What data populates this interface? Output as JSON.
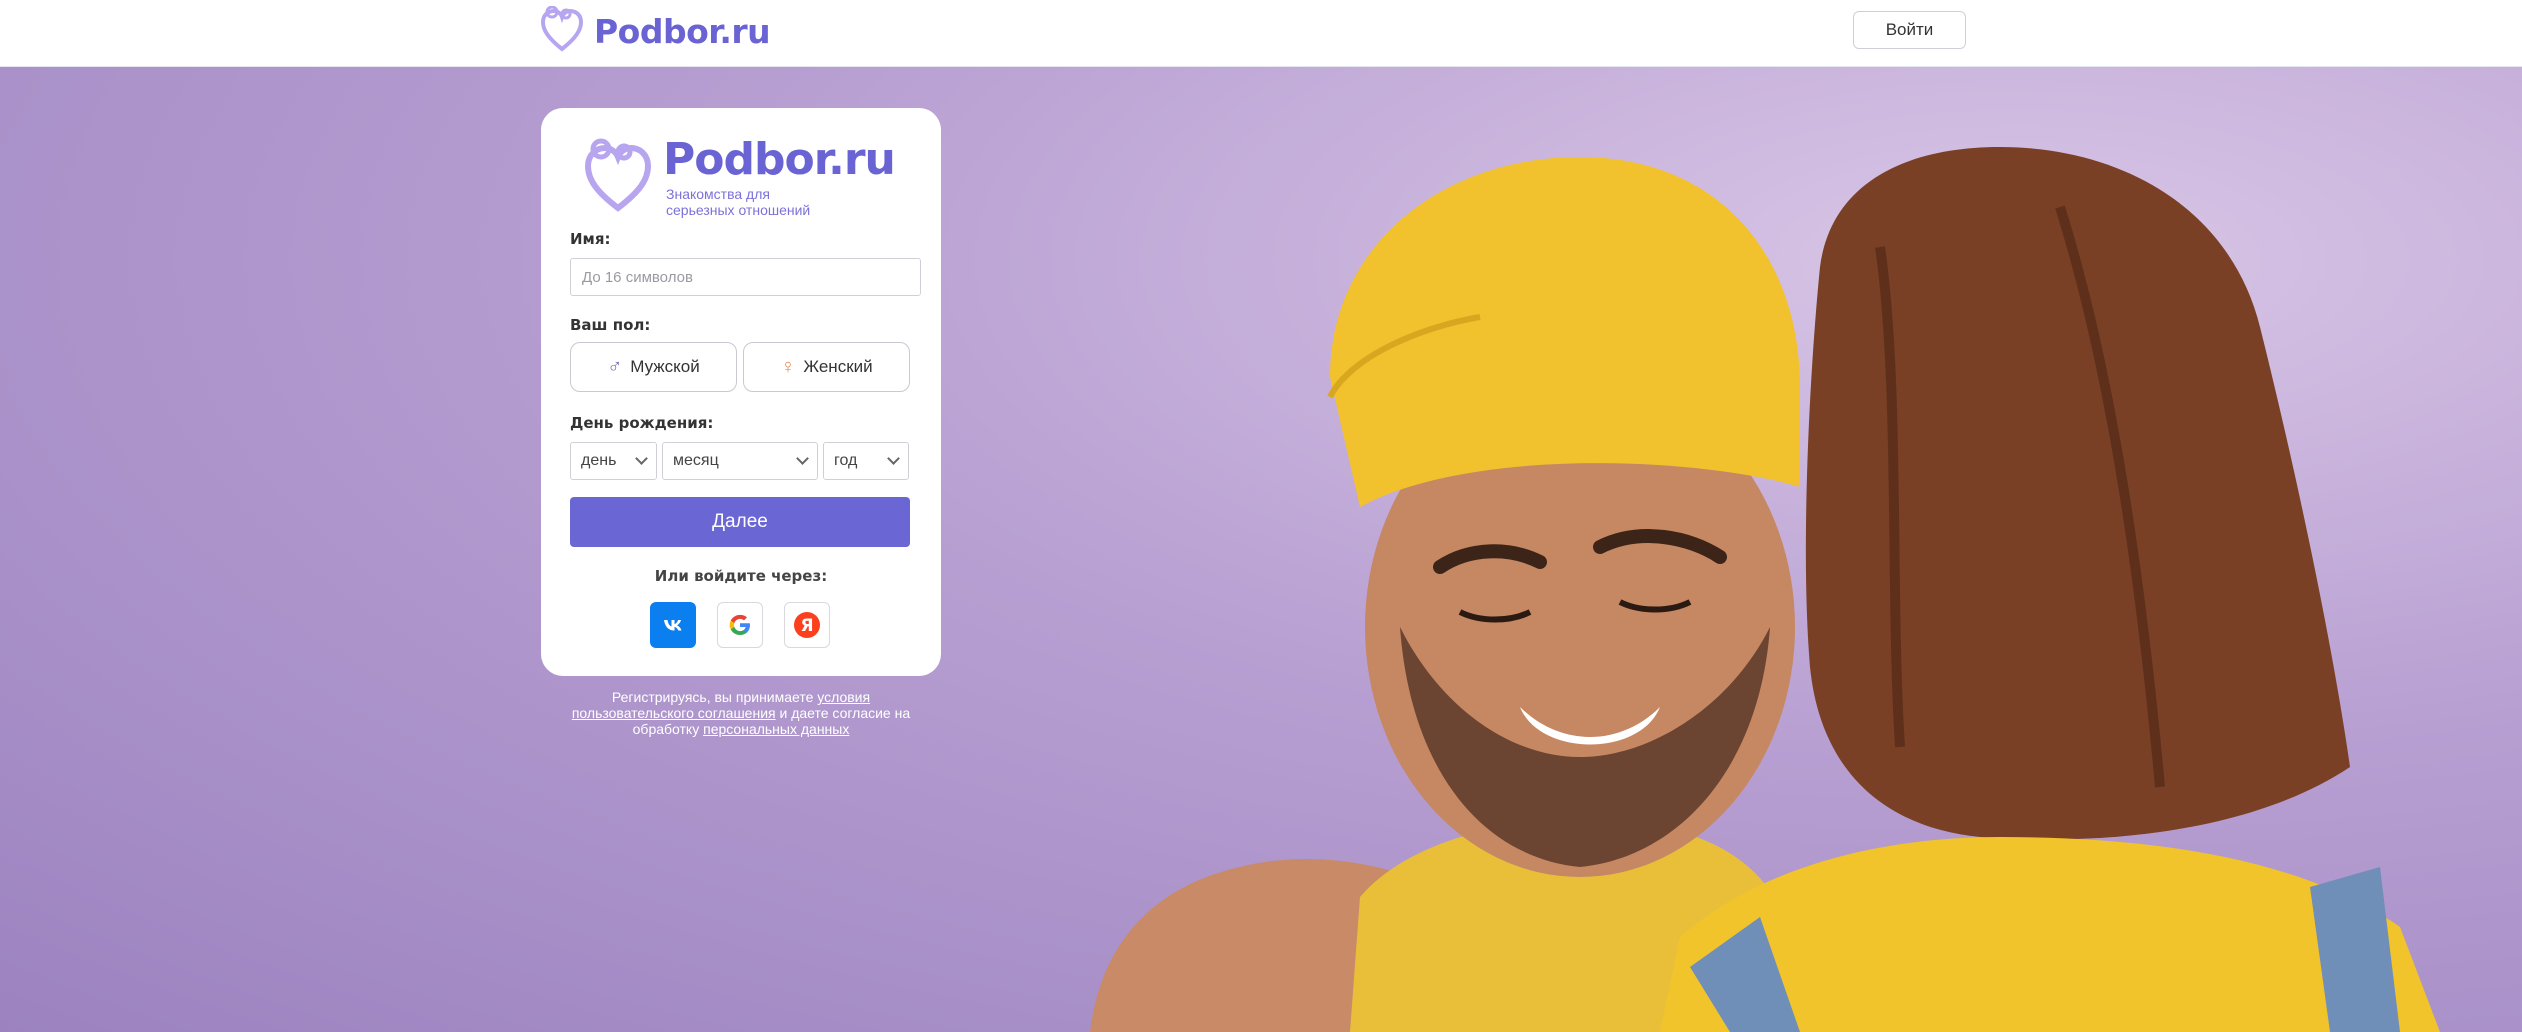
{
  "header": {
    "brand": "Podbor.ru",
    "login_label": "Войти"
  },
  "card": {
    "logo_title": "Podbor.ru",
    "logo_subtitle": "Знакомства для серьезных отношений",
    "name_label": "Имя:",
    "name_placeholder": "До 16 символов",
    "name_value": "",
    "gender_label": "Ваш пол:",
    "gender_male": "Мужской",
    "gender_female": "Женский",
    "birthday_label": "День рождения:",
    "day_value": "день",
    "month_value": "месяц",
    "year_value": "год",
    "next_label": "Далее",
    "or_login_label": "Или войдите через:",
    "social": [
      {
        "name": "vk",
        "icon": "vk-icon",
        "color": "#0b7ef0"
      },
      {
        "name": "google",
        "icon": "google-icon"
      },
      {
        "name": "yandex",
        "icon": "yandex-icon",
        "color": "#fc3f1d"
      }
    ]
  },
  "terms": {
    "text_1": "Регистрируясь, вы принимаете ",
    "link_1": "условия пользовательского соглашения",
    "text_2": " и даете согласие на обработку ",
    "link_2": "персональных данных"
  },
  "colors": {
    "brand": "#6a63d4",
    "button": "#6a66d4",
    "hero_background": "#b79fd2"
  }
}
